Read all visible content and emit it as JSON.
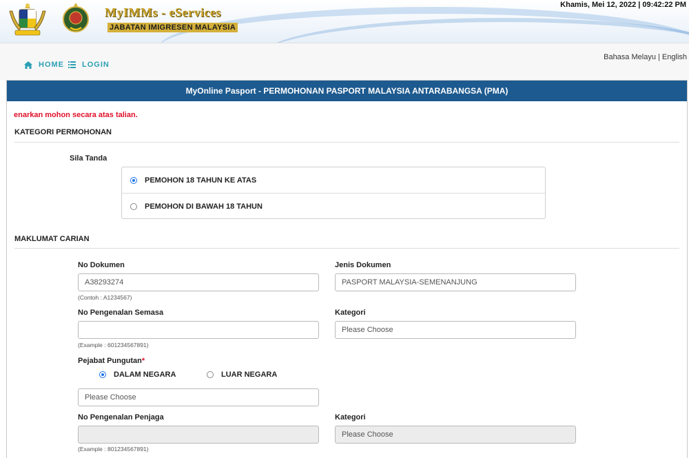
{
  "header": {
    "brand": "MyIMMs - eServices",
    "department": "JABATAN IMIGRESEN MALAYSIA",
    "datetime": "Khamis, Mei 12, 2022 | 09:42:22 PM"
  },
  "nav": {
    "home": "HOME",
    "login": "LOGIN",
    "lang_ms": "Bahasa Melayu",
    "lang_sep": " | ",
    "lang_en": "English"
  },
  "panel": {
    "title": "MyOnline Pasport - PERMOHONAN PASPORT MALAYSIA ANTARABANGSA (PMA)",
    "notice": "enarkan mohon secara atas talian."
  },
  "kategori": {
    "heading": "KATEGORI PERMOHONAN",
    "sila_tanda": "Sila Tanda",
    "options": [
      {
        "label": "PEMOHON 18 TAHUN KE ATAS",
        "checked": true
      },
      {
        "label": "PEMOHON DI BAWAH 18 TAHUN",
        "checked": false
      }
    ]
  },
  "carian": {
    "heading": "MAKLUMAT CARIAN",
    "no_dokumen": {
      "label": "No Dokumen",
      "value": "A38293274",
      "hint": "(Contoh : A1234567)"
    },
    "jenis_dokumen": {
      "label": "Jenis Dokumen",
      "value": "PASPORT MALAYSIA-SEMENANJUNG"
    },
    "no_pengenalan_semasa": {
      "label": "No Pengenalan Semasa",
      "value": "",
      "hint": "(Example : 601234567891)"
    },
    "kategori1": {
      "label": "Kategori",
      "placeholder": "Please Choose"
    },
    "pejabat": {
      "label": "Pejabat Pungutan",
      "required": "*",
      "options": [
        {
          "label": "DALAM NEGARA",
          "checked": true
        },
        {
          "label": "LUAR NEGARA",
          "checked": false
        }
      ],
      "placeholder": "Please Choose"
    },
    "no_pengenalan_penjaga": {
      "label": "No Pengenalan Penjaga",
      "value": "",
      "hint": "(Example : 801234567891)"
    },
    "kategori2": {
      "label": "Kategori",
      "placeholder": "Please Choose"
    }
  },
  "colors": {
    "panel_header": "#1d5a8f",
    "nav_link": "#2a9fb4",
    "notice": "#e0102a",
    "radio_accent": "#1a73e8"
  }
}
